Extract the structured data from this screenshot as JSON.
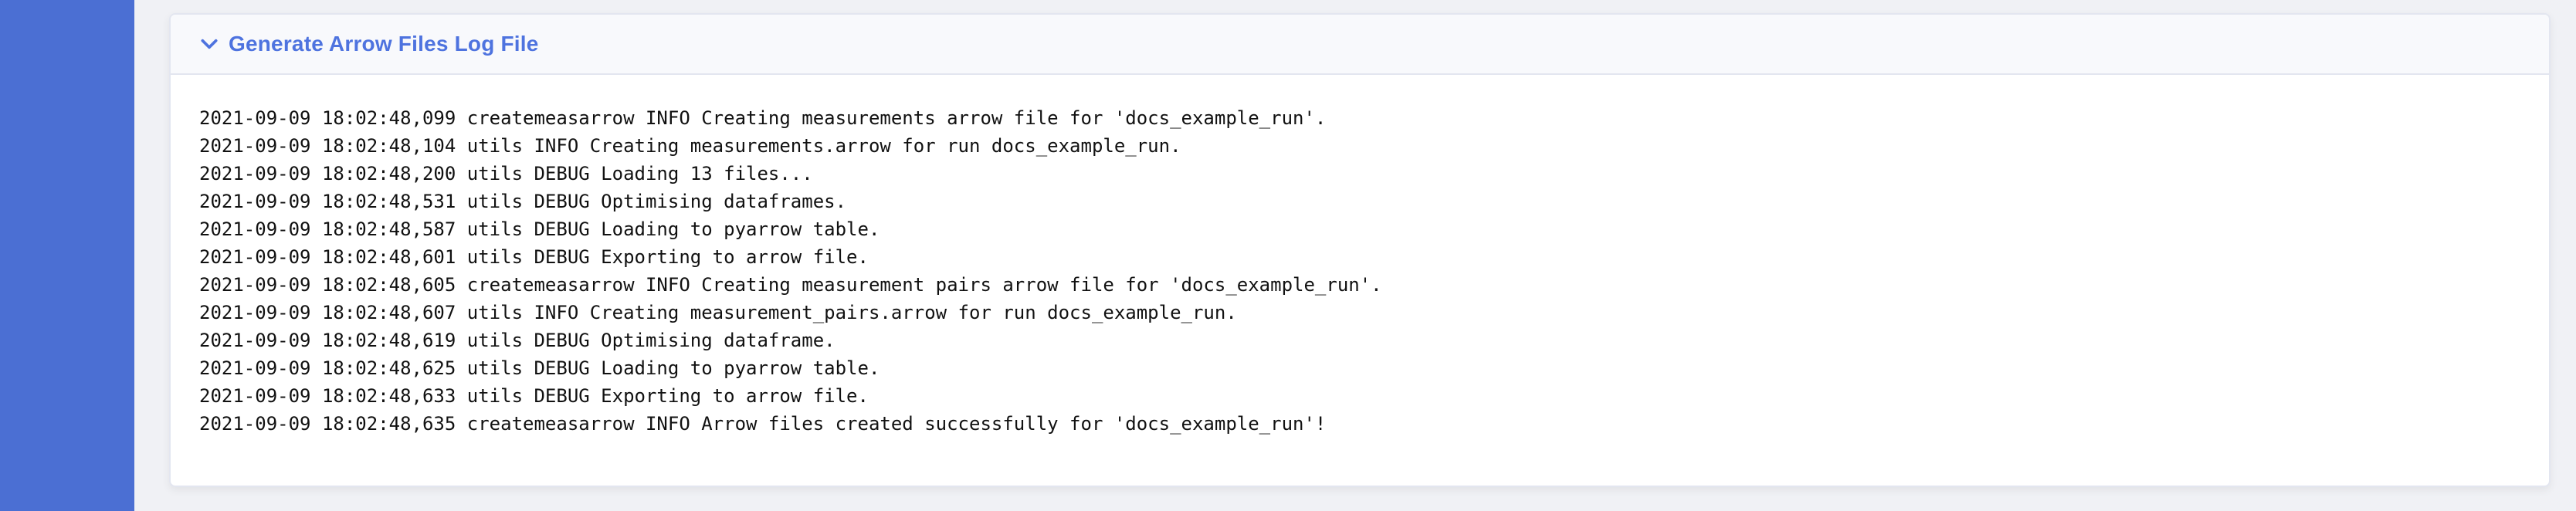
{
  "panel": {
    "title": "Generate Arrow Files Log File",
    "chevron_icon": "chevron-down-icon",
    "accent_color": "#4e73df",
    "sidebar_color": "#4b6fd3"
  },
  "log": {
    "lines": [
      "2021-09-09 18:02:48,099 createmeasarrow INFO Creating measurements arrow file for 'docs_example_run'.",
      "2021-09-09 18:02:48,104 utils INFO Creating measurements.arrow for run docs_example_run.",
      "2021-09-09 18:02:48,200 utils DEBUG Loading 13 files...",
      "2021-09-09 18:02:48,531 utils DEBUG Optimising dataframes.",
      "2021-09-09 18:02:48,587 utils DEBUG Loading to pyarrow table.",
      "2021-09-09 18:02:48,601 utils DEBUG Exporting to arrow file.",
      "2021-09-09 18:02:48,605 createmeasarrow INFO Creating measurement pairs arrow file for 'docs_example_run'.",
      "2021-09-09 18:02:48,607 utils INFO Creating measurement_pairs.arrow for run docs_example_run.",
      "2021-09-09 18:02:48,619 utils DEBUG Optimising dataframe.",
      "2021-09-09 18:02:48,625 utils DEBUG Loading to pyarrow table.",
      "2021-09-09 18:02:48,633 utils DEBUG Exporting to arrow file.",
      "2021-09-09 18:02:48,635 createmeasarrow INFO Arrow files created successfully for 'docs_example_run'!"
    ]
  }
}
